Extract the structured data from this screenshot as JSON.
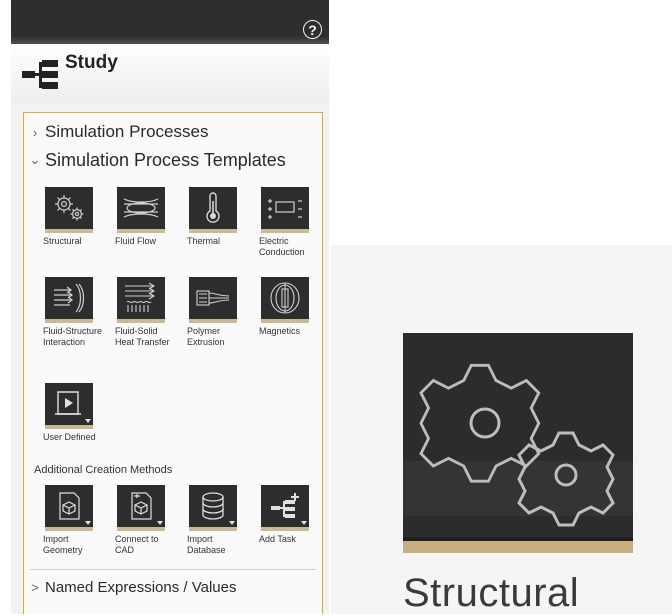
{
  "panel": {
    "title": "Study",
    "help_glyph": "?",
    "tree": {
      "simulation_processes": "Simulation Processes",
      "simulation_process_templates": "Simulation Process Templates",
      "templates": [
        {
          "label": "Structural",
          "icon": "gears-icon"
        },
        {
          "label": "Fluid Flow",
          "icon": "fluid-flow-icon"
        },
        {
          "label": "Thermal",
          "icon": "thermometer-icon"
        },
        {
          "label": "Electric Conduction",
          "icon": "electric-conduction-icon"
        },
        {
          "label": "Fluid-Structure Interaction",
          "icon": "fluid-structure-icon"
        },
        {
          "label": "Fluid-Solid Heat Transfer",
          "icon": "fluid-solid-heat-icon"
        },
        {
          "label": "Polymer Extrusion",
          "icon": "polymer-extrusion-icon"
        },
        {
          "label": "Magnetics",
          "icon": "magnetics-icon"
        },
        {
          "label": "User Defined",
          "icon": "user-defined-icon"
        }
      ],
      "additional_creation_methods": "Additional Creation Methods",
      "creation_methods": [
        {
          "label": "Import Geometry",
          "icon": "import-geometry-icon"
        },
        {
          "label": "Connect to CAD",
          "icon": "connect-cad-icon"
        },
        {
          "label": "Import Database",
          "icon": "import-database-icon"
        },
        {
          "label": "Add Task",
          "icon": "add-task-icon"
        }
      ],
      "named_expressions": "Named Expressions / Values"
    }
  },
  "zoom": {
    "label": "Structural",
    "icon": "gears-icon"
  },
  "colors": {
    "topbar": "#2e2e2e",
    "tile": "#2d2d2d",
    "tile_accent": "#cbb894",
    "tree_border": "#e3a540"
  }
}
